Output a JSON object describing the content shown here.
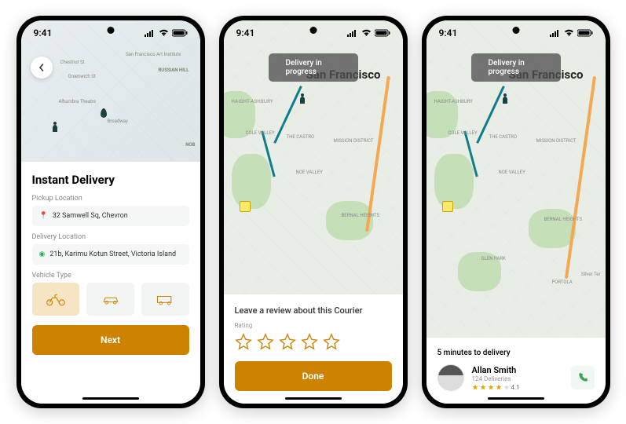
{
  "status": {
    "time": "9:41"
  },
  "screen1": {
    "title": "Instant Delivery",
    "pickup_label": "Pickup Location",
    "pickup_value": "32 Samwell Sq, Chevron",
    "delivery_label": "Delivery Location",
    "delivery_value": "21b, Karimu Kotun Street, Victoria Island",
    "vehicle_label": "Vehicle Type",
    "next": "Next",
    "map_labels": [
      "Chestnut St",
      "Greenwich St",
      "Alhambra Theatre",
      "Broadway",
      "RUSSIAN HILL",
      "NOB",
      "San Francisco Art Institute"
    ]
  },
  "screen2": {
    "banner": "Delivery in progress",
    "city": "San Francisco",
    "prompt": "Leave a review about this Courier",
    "rating_label": "Rating",
    "done": "Done",
    "districts": [
      "HAIGHT-ASHBURY",
      "COLE VALLEY",
      "THE CASTRO",
      "MISSION DISTRICT",
      "NOE VALLEY",
      "BERNAL HEIGHTS"
    ]
  },
  "screen3": {
    "banner": "Delivery in progress",
    "city": "San Francisco",
    "eta": "5 minutes to delivery",
    "driver_name": "Allan Smith",
    "driver_sub": "124 Deliveries",
    "driver_rating": "4.1",
    "districts": [
      "HAIGHT-ASHBURY",
      "COLE VALLEY",
      "THE CASTRO",
      "MISSION DISTRICT",
      "NOE VALLEY",
      "BERNAL HEIGHTS",
      "GLEN PARK",
      "PORTOLA",
      "Silver Ter"
    ]
  },
  "colors": {
    "accent": "#cc8400"
  }
}
